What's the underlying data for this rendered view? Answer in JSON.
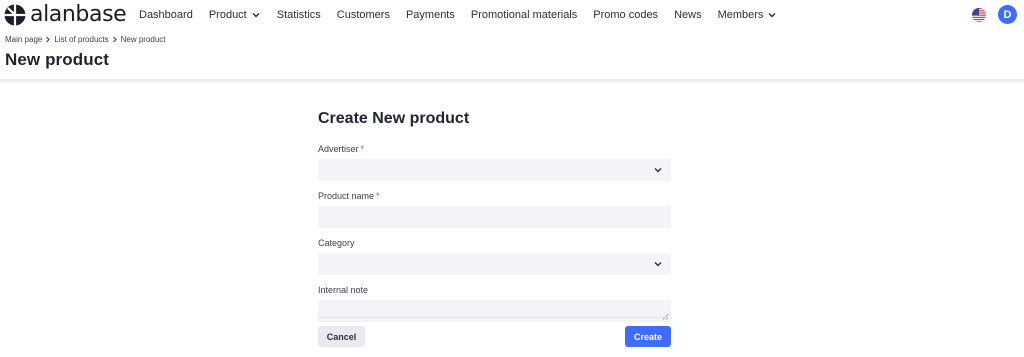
{
  "brand": {
    "name": "alanbase"
  },
  "nav": {
    "items": [
      {
        "label": "Dashboard",
        "has_dropdown": false
      },
      {
        "label": "Product",
        "has_dropdown": true
      },
      {
        "label": "Statistics",
        "has_dropdown": false
      },
      {
        "label": "Customers",
        "has_dropdown": false
      },
      {
        "label": "Payments",
        "has_dropdown": false
      },
      {
        "label": "Promotional materials",
        "has_dropdown": false
      },
      {
        "label": "Promo codes",
        "has_dropdown": false
      },
      {
        "label": "News",
        "has_dropdown": false
      },
      {
        "label": "Members",
        "has_dropdown": true
      }
    ],
    "language_icon": "us-flag-icon",
    "avatar_initial": "D",
    "avatar_color": "#3d6dfa"
  },
  "breadcrumb": [
    "Main page",
    "List of products",
    "New product"
  ],
  "page": {
    "title": "New product"
  },
  "form": {
    "title": "Create New product",
    "fields": {
      "advertiser": {
        "label": "Advertiser",
        "required": true,
        "value": "",
        "type": "select"
      },
      "product_name": {
        "label": "Product name",
        "required": true,
        "value": "",
        "type": "text"
      },
      "category": {
        "label": "Category",
        "required": false,
        "value": "",
        "type": "select"
      },
      "internal_note": {
        "label": "Internal note",
        "required": false,
        "value": "",
        "type": "textarea"
      }
    },
    "required_marker": "*",
    "cancel_label": "Cancel",
    "create_label": "Create"
  },
  "colors": {
    "accent": "#3d6dfa",
    "required": "#e0434b",
    "field_bg": "#f3f4f8"
  }
}
